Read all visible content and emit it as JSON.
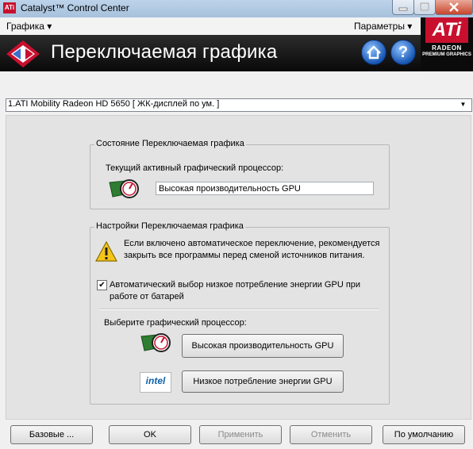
{
  "window": {
    "title": "Catalyst™ Control Center",
    "logo_text": "ATi"
  },
  "menu": {
    "graphics": "Графика ▾",
    "params": "Параметры ▾"
  },
  "header": {
    "title": "Переключаемая графика"
  },
  "brand": {
    "ati": "ATi",
    "radeon": "RADEON",
    "premium": "PREMIUM GRAPHICS"
  },
  "device": {
    "selected": "1.ATI Mobility Radeon HD 5650 [ ЖК-дисплей по ум. ]"
  },
  "status_group": {
    "legend": "Состояние Переключаемая графика",
    "active_label": "Текущий активный графический процессор:",
    "active_value": "Высокая производительность GPU"
  },
  "settings_group": {
    "legend": "Настройки Переключаемая графика",
    "warning": "Если включено автоматическое переключение, рекомендуется закрыть все программы перед сменой источников питания.",
    "auto_switch_label": "Автоматический выбор низкое потребление энергии GPU при работе от батарей",
    "auto_switch_checked": true,
    "choose_label": "Выберите графический процессор:",
    "high_perf_button": "Высокая производительность GPU",
    "low_power_button": "Низкое потребление энергии GPU",
    "intel_logo": "intel"
  },
  "buttons": {
    "basic": "Базовые ...",
    "ok": "OK",
    "apply": "Применить",
    "cancel": "Отменить",
    "default": "По умолчанию"
  }
}
